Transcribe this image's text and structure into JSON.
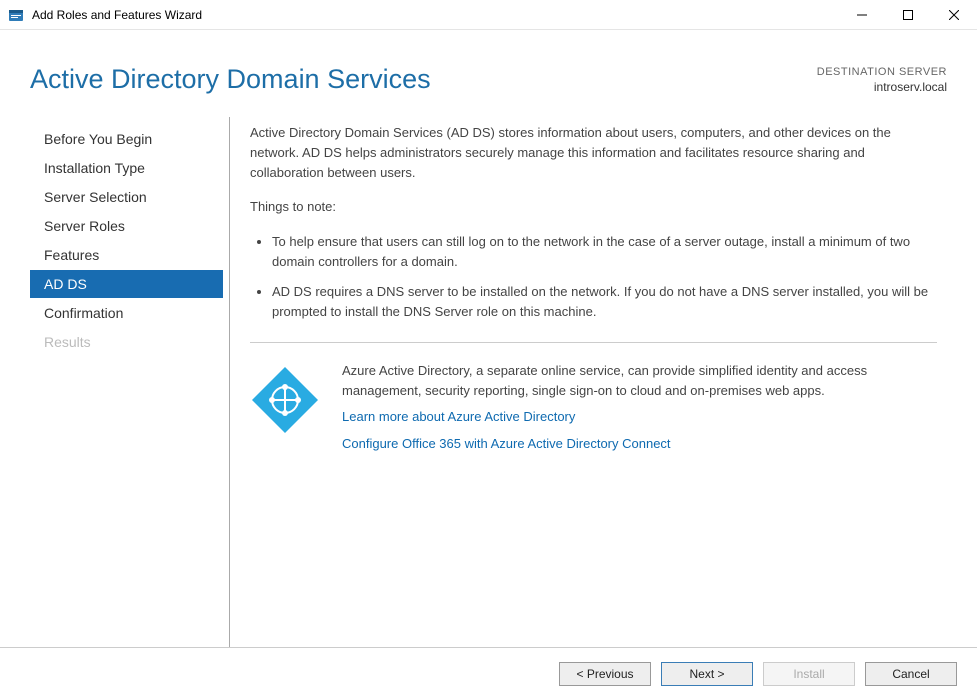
{
  "window": {
    "title": "Add Roles and Features Wizard"
  },
  "header": {
    "page_title": "Active Directory Domain Services",
    "dest_label": "DESTINATION SERVER",
    "dest_value": "introserv.local"
  },
  "sidebar": {
    "items": [
      {
        "label": "Before You Begin"
      },
      {
        "label": "Installation Type"
      },
      {
        "label": "Server Selection"
      },
      {
        "label": "Server Roles"
      },
      {
        "label": "Features"
      },
      {
        "label": "AD DS"
      },
      {
        "label": "Confirmation"
      },
      {
        "label": "Results"
      }
    ]
  },
  "content": {
    "intro": "Active Directory Domain Services (AD DS) stores information about users, computers, and other devices on the network.  AD DS helps administrators securely manage this information and facilitates resource sharing and collaboration between users.",
    "note_heading": "Things to note:",
    "notes": [
      "To help ensure that users can still log on to the network in the case of a server outage, install a minimum of two domain controllers for a domain.",
      "AD DS requires a DNS server to be installed on the network.  If you do not have a DNS server installed, you will be prompted to install the DNS Server role on this machine."
    ],
    "azure": {
      "desc": "Azure Active Directory, a separate online service, can provide simplified identity and access management, security reporting, single sign-on to cloud and on-premises web apps.",
      "link1": "Learn more about Azure Active Directory",
      "link2": "Configure Office 365 with Azure Active Directory Connect"
    }
  },
  "footer": {
    "previous": "< Previous",
    "next": "Next >",
    "install": "Install",
    "cancel": "Cancel"
  }
}
